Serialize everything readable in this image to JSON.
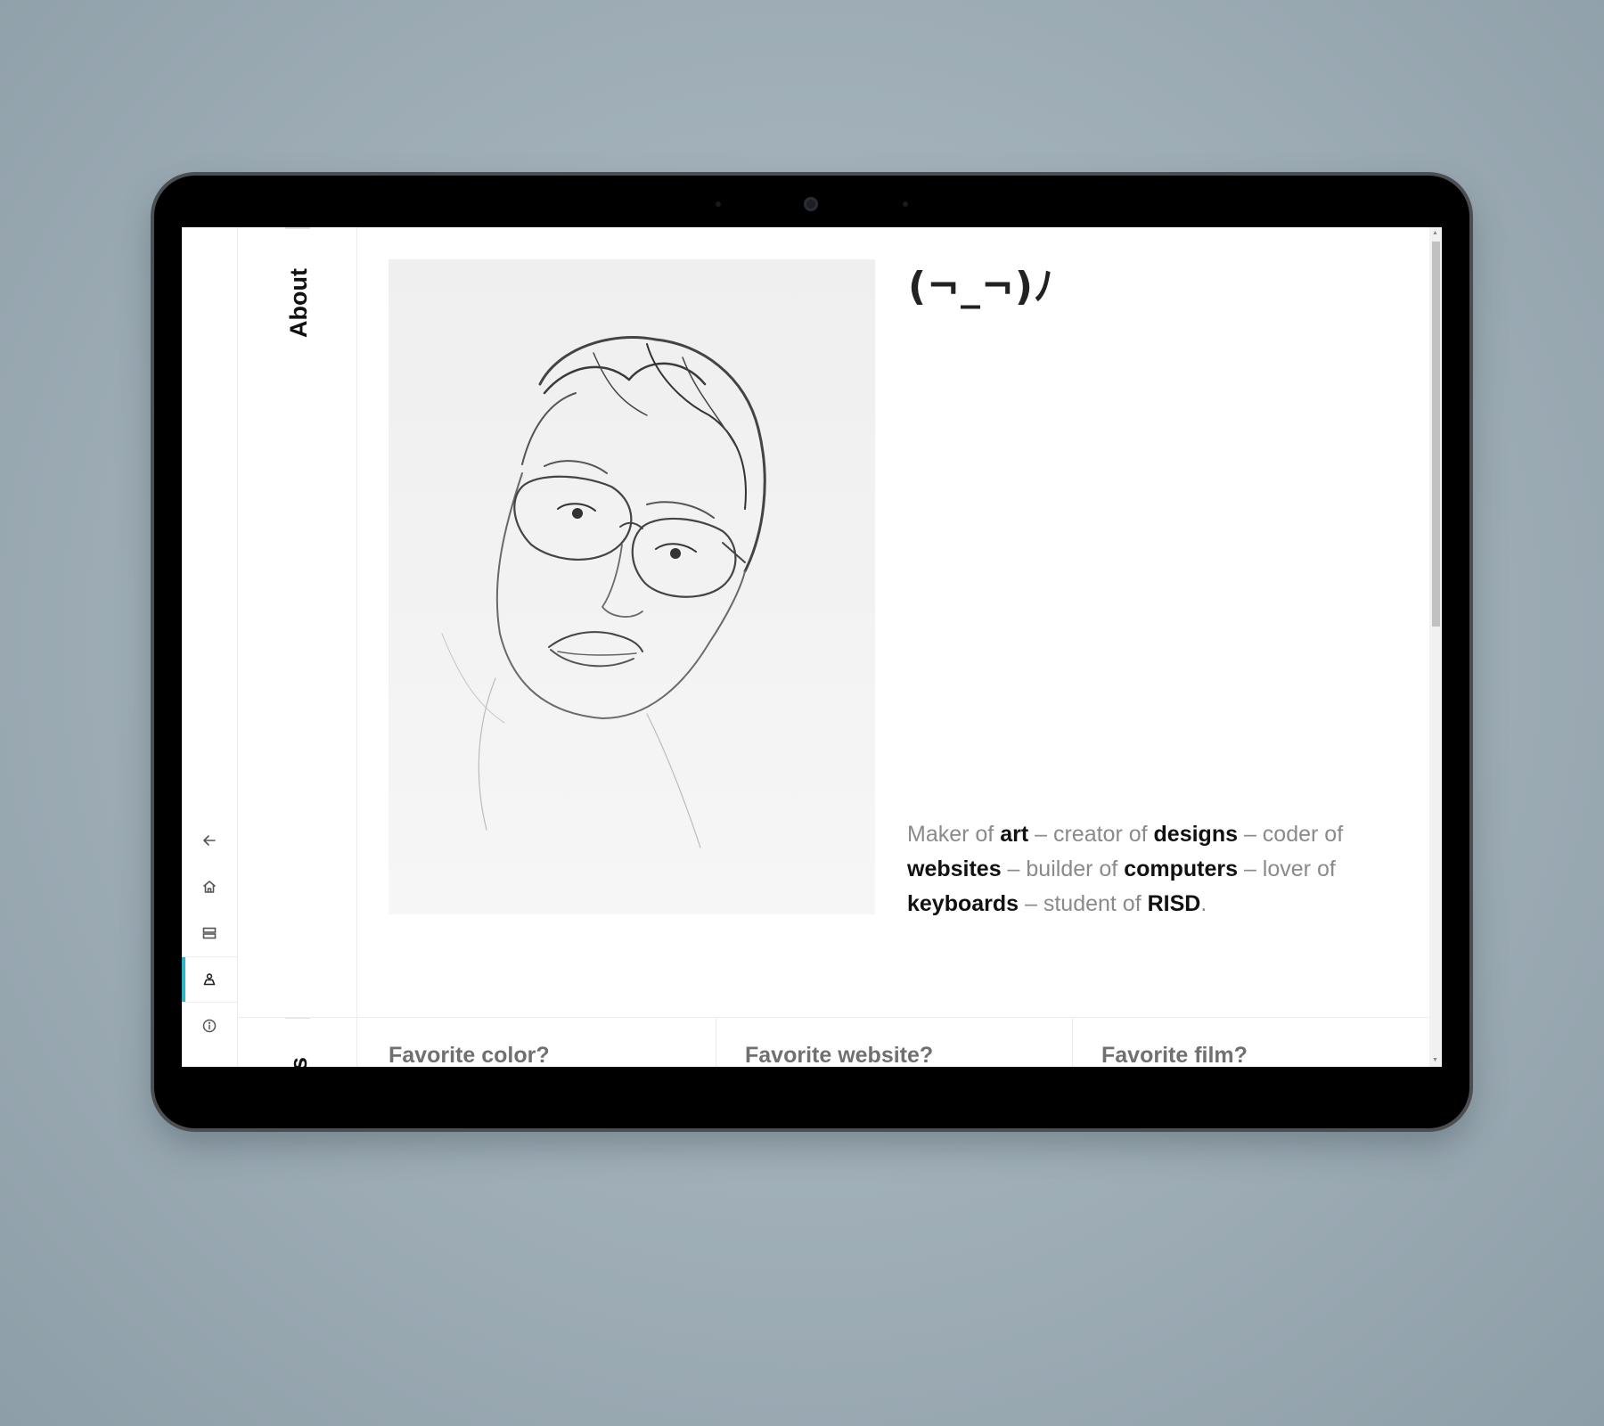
{
  "nav": {
    "items": [
      {
        "name": "back",
        "icon": "arrow-left-icon"
      },
      {
        "name": "home",
        "icon": "home-icon"
      },
      {
        "name": "projects",
        "icon": "layout-rows-icon"
      },
      {
        "name": "about",
        "icon": "person-icon",
        "active": true
      },
      {
        "name": "info",
        "icon": "info-icon"
      }
    ],
    "accent_color": "#2cb5c7"
  },
  "sections": {
    "about_label": "About",
    "next_label_partial": "s"
  },
  "about": {
    "portrait_alt": "Pencil self-portrait drawing",
    "kaomoji": "(¬_¬)ﾉ",
    "bio": [
      {
        "text": "Maker of ",
        "emphasis": false
      },
      {
        "text": "art",
        "emphasis": true
      },
      {
        "text": " – creator of ",
        "emphasis": false
      },
      {
        "text": "designs",
        "emphasis": true
      },
      {
        "text": " – coder of ",
        "emphasis": false
      },
      {
        "text": "websites",
        "emphasis": true
      },
      {
        "text": " – builder of ",
        "emphasis": false
      },
      {
        "text": "computers",
        "emphasis": true
      },
      {
        "text": " – lover of ",
        "emphasis": false
      },
      {
        "text": "keyboards",
        "emphasis": true
      },
      {
        "text": " – student of ",
        "emphasis": false
      },
      {
        "text": "RISD",
        "emphasis": true
      },
      {
        "text": ".",
        "emphasis": false
      }
    ]
  },
  "favorites": {
    "questions": [
      "Favorite color?",
      "Favorite website?",
      "Favorite film?"
    ]
  }
}
